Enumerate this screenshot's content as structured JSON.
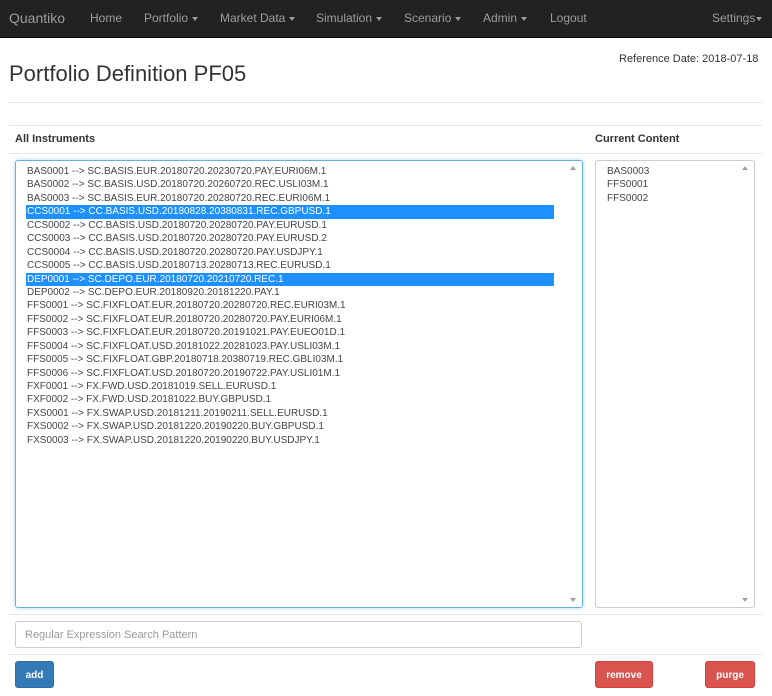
{
  "navbar": {
    "brand": "Quantiko",
    "items": [
      {
        "label": "Home",
        "dropdown": false
      },
      {
        "label": "Portfolio",
        "dropdown": true
      },
      {
        "label": "Market Data",
        "dropdown": true
      },
      {
        "label": "Simulation",
        "dropdown": true
      },
      {
        "label": "Scenario",
        "dropdown": true
      },
      {
        "label": "Admin",
        "dropdown": true
      },
      {
        "label": "Logout",
        "dropdown": false
      }
    ],
    "settings": "Settings"
  },
  "header": {
    "reference_date": "Reference Date: 2018-07-18",
    "title": "Portfolio Definition PF05"
  },
  "all_instruments": {
    "heading": "All Instruments",
    "items": [
      {
        "label": "BAS0001 --> SC.BASIS.EUR.20180720.20230720.PAY.EURI06M.1",
        "selected": false
      },
      {
        "label": "BAS0002 --> SC.BASIS.USD.20180720.20260720.REC.USLI03M.1",
        "selected": false
      },
      {
        "label": "BAS0003 --> SC.BASIS.EUR.20180720.20280720.REC.EURI06M.1",
        "selected": false
      },
      {
        "label": "CCS0001 --> CC.BASIS.USD.20180828.20380831.REC.GBPUSD.1",
        "selected": true
      },
      {
        "label": "CCS0002 --> CC.BASIS.USD.20180720.20280720.PAY.EURUSD.1",
        "selected": false
      },
      {
        "label": "CCS0003 --> CC.BASIS.USD.20180720.20280720.PAY.EURUSD.2",
        "selected": false
      },
      {
        "label": "CCS0004 --> CC.BASIS.USD.20180720.20280720.PAY.USDJPY.1",
        "selected": false
      },
      {
        "label": "CCS0005 --> CC.BASIS.USD.20180713.20280713.REC.EURUSD.1",
        "selected": false
      },
      {
        "label": "DEP0001 --> SC.DEPO.EUR.20180720.20210720.REC.1",
        "selected": true
      },
      {
        "label": "DEP0002 --> SC.DEPO.EUR.20180920.20181220.PAY.1",
        "selected": false
      },
      {
        "label": "FFS0001 --> SC.FIXFLOAT.EUR.20180720.20280720.REC.EURI03M.1",
        "selected": false
      },
      {
        "label": "FFS0002 --> SC.FIXFLOAT.EUR.20180720.20280720.PAY.EURI06M.1",
        "selected": false
      },
      {
        "label": "FFS0003 --> SC.FIXFLOAT.EUR.20180720.20191021.PAY.EUEO01D.1",
        "selected": false
      },
      {
        "label": "FFS0004 --> SC.FIXFLOAT.USD.20181022.20281023.PAY.USLI03M.1",
        "selected": false
      },
      {
        "label": "FFS0005 --> SC.FIXFLOAT.GBP.20180718.20380719.REC.GBLI03M.1",
        "selected": false
      },
      {
        "label": "FFS0006 --> SC.FIXFLOAT.USD.20180720.20190722.PAY.USLI01M.1",
        "selected": false
      },
      {
        "label": "FXF0001 --> FX.FWD.USD.20181019.SELL.EURUSD.1",
        "selected": false
      },
      {
        "label": "FXF0002 --> FX.FWD.USD.20181022.BUY.GBPUSD.1",
        "selected": false
      },
      {
        "label": "FXS0001 --> FX.SWAP.USD.20181211.20190211.SELL.EURUSD.1",
        "selected": false
      },
      {
        "label": "FXS0002 --> FX.SWAP.USD.20181220.20190220.BUY.GBPUSD.1",
        "selected": false
      },
      {
        "label": "FXS0003 --> FX.SWAP.USD.20181220.20190220.BUY.USDJPY.1",
        "selected": false
      }
    ]
  },
  "current_content": {
    "heading": "Current Content",
    "items": [
      "BAS0003",
      "FFS0001",
      "FFS0002"
    ]
  },
  "search": {
    "placeholder": "Regular Expression Search Pattern",
    "value": ""
  },
  "buttons": {
    "add": "add",
    "remove": "remove",
    "purge": "purge"
  },
  "colors": {
    "navbar": "#222222",
    "selection": "#1e90ff",
    "primary": "#337ab7",
    "danger": "#d9534f",
    "focus_border": "#66afe9"
  },
  "icons": {
    "caret": "caret-down-icon",
    "scroll_up": "scroll-up-arrow-icon",
    "scroll_down": "scroll-down-arrow-icon"
  }
}
